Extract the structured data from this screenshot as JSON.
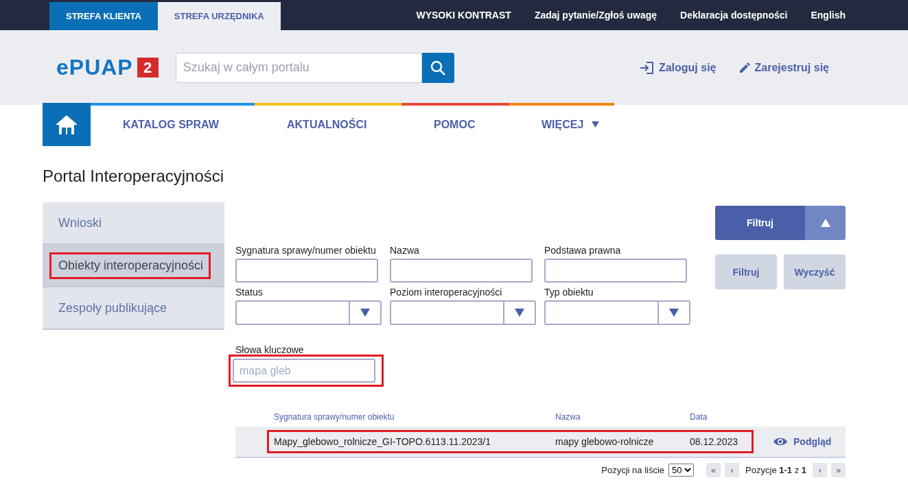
{
  "top_bar": {
    "zones": [
      {
        "label": "STREFA KLIENTA",
        "selected": false
      },
      {
        "label": "STREFA URZĘDNIKA",
        "selected": true
      }
    ],
    "links": [
      "WYSOKI KONTRAST",
      "Zadaj pytanie/Zgłoś uwagę",
      "Deklaracja dostępności",
      "English"
    ]
  },
  "header": {
    "logo": {
      "text": "ePUAP",
      "badge": "2"
    },
    "search": {
      "placeholder": "Szukaj w całym portalu"
    },
    "actions": [
      {
        "label": "Zaloguj się",
        "kind": "login"
      },
      {
        "label": "Zarejestruj się",
        "kind": "register"
      }
    ]
  },
  "nav": {
    "items": [
      {
        "label": "KATALOG SPRAW",
        "color": "#1e95e6",
        "has_menu": false
      },
      {
        "label": "AKTUALNOŚCI",
        "color": "#f2c01e",
        "has_menu": false
      },
      {
        "label": "POMOC",
        "color": "#e8473c",
        "has_menu": false
      },
      {
        "label": "WIĘCEJ",
        "color": "#f0870f",
        "has_menu": true
      }
    ]
  },
  "page_title": "Portal Interoperacyjności",
  "sidebar": {
    "items": [
      {
        "label": "Wnioski",
        "selected": false,
        "highlighted": false
      },
      {
        "label": "Obiekty interoperacyjności",
        "selected": true,
        "highlighted": true
      },
      {
        "label": "Zespoły publikujące",
        "selected": false,
        "highlighted": false
      }
    ]
  },
  "filters": {
    "fields": [
      {
        "label": "Sygnatura sprawy/numer obiektu",
        "kind": "text",
        "highlighted": false
      },
      {
        "label": "Nazwa",
        "kind": "text",
        "highlighted": false
      },
      {
        "label": "Podstawa prawna",
        "kind": "text",
        "highlighted": false
      },
      {
        "label": "Status",
        "kind": "select",
        "highlighted": false
      },
      {
        "label": "Poziom interoperacyjności",
        "kind": "select",
        "highlighted": false
      },
      {
        "label": "Typ obiektu",
        "kind": "select",
        "highlighted": false
      },
      {
        "label": "Słowa kluczowe",
        "kind": "text",
        "value": "mapa gleb",
        "highlighted": true
      }
    ],
    "toggle": {
      "label": "Filtruj",
      "expanded": true
    },
    "buttons": [
      "Filtruj",
      "Wyczyść"
    ]
  },
  "results": {
    "columns": [
      "Sygnatura sprawy/numer obiektu",
      "Nazwa",
      "Data"
    ],
    "rows": [
      {
        "cells": [
          "Mapy_glebowo_rolnicze_GI-TOPO.6113.11.2023/1",
          "mapy glebowo-rolnicze",
          "08.12.2023"
        ],
        "action": "Podgląd",
        "highlighted": true
      }
    ],
    "pagination": {
      "page_size_label": "Pozycji na liście",
      "page_size": "50",
      "first": "«",
      "prev": "‹",
      "summary": "Pozycje **1-1** z **1**",
      "next": "›",
      "last": "»"
    }
  }
}
